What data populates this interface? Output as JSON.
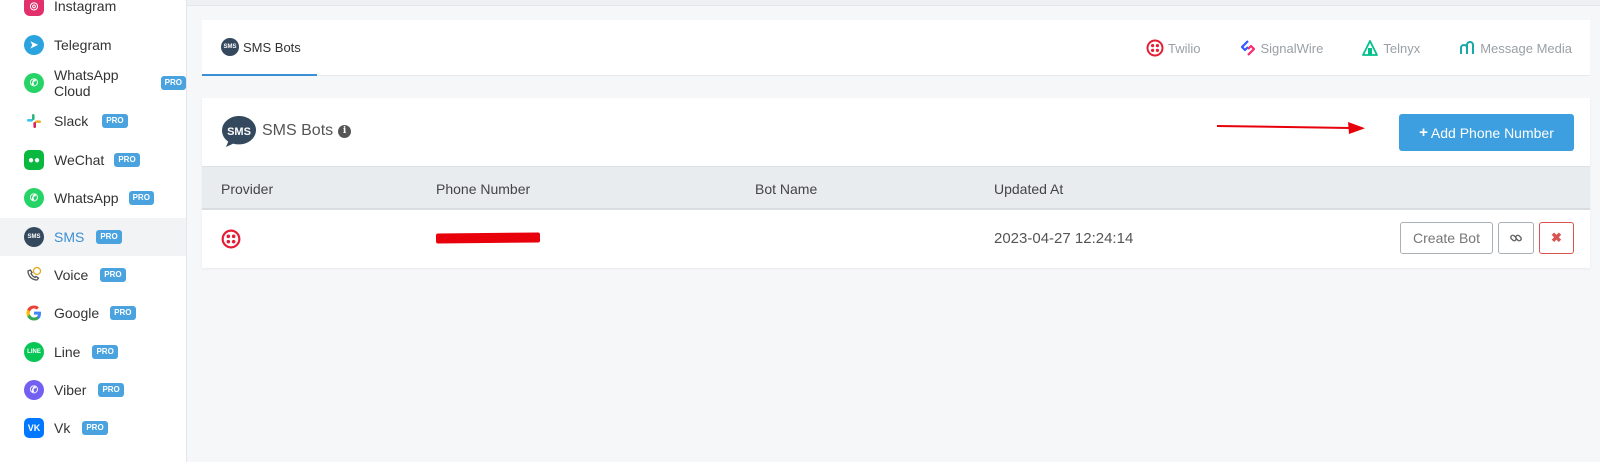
{
  "sidebar": {
    "items": [
      {
        "label": "Instagram",
        "pro": "",
        "icon": "instagram-icon"
      },
      {
        "label": "Telegram",
        "pro": "",
        "icon": "telegram-icon"
      },
      {
        "label": "WhatsApp Cloud",
        "pro": "PRO",
        "icon": "whatsapp-icon"
      },
      {
        "label": "Slack",
        "pro": "PRO",
        "icon": "slack-icon"
      },
      {
        "label": "WeChat",
        "pro": "PRO",
        "icon": "wechat-icon"
      },
      {
        "label": "WhatsApp",
        "pro": "PRO",
        "icon": "whatsapp-icon"
      },
      {
        "label": "SMS",
        "pro": "PRO",
        "icon": "sms-icon",
        "active": true
      },
      {
        "label": "Voice",
        "pro": "PRO",
        "icon": "voice-icon"
      },
      {
        "label": "Google",
        "pro": "PRO",
        "icon": "google-icon"
      },
      {
        "label": "Line",
        "pro": "PRO",
        "icon": "line-icon"
      },
      {
        "label": "Viber",
        "pro": "PRO",
        "icon": "viber-icon"
      },
      {
        "label": "Vk",
        "pro": "PRO",
        "icon": "vk-icon"
      }
    ]
  },
  "tabs": {
    "active_label": "SMS Bots",
    "providers": [
      "Twilio",
      "SignalWire",
      "Telnyx",
      "Message Media"
    ]
  },
  "card": {
    "icon_text": "SMS",
    "title": "SMS Bots",
    "add_button": "Add Phone Number"
  },
  "table": {
    "headers": [
      "Provider",
      "Phone Number",
      "Bot Name",
      "Updated At"
    ],
    "rows": [
      {
        "provider_icon": "twilio-icon",
        "phone": "",
        "bot_name": "",
        "updated_at": "2023-04-27 12:24:14"
      }
    ],
    "actions": {
      "create_bot": "Create Bot",
      "link_icon": "link-icon",
      "delete_icon": "close-icon",
      "delete_glyph": "✖"
    }
  },
  "colors": {
    "accent": "#3d9fe0",
    "twilio": "#e31e35",
    "danger": "#d9534f",
    "annotation_arrow": "#e8000b"
  }
}
